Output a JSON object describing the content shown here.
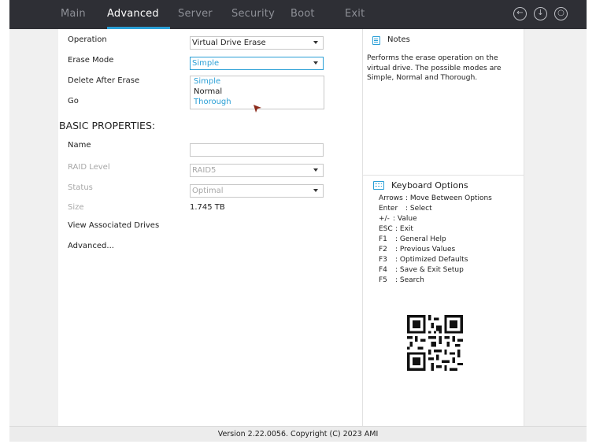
{
  "tabs": [
    {
      "label": "Main"
    },
    {
      "label": "Advanced"
    },
    {
      "label": "Server"
    },
    {
      "label": "Security"
    },
    {
      "label": "Boot"
    },
    {
      "label": "Exit"
    }
  ],
  "active_tab": "Advanced",
  "top_icons": [
    "back-icon",
    "save-icon",
    "search-icon"
  ],
  "form": {
    "operation_label": "Operation",
    "operation_value": "Virtual Drive Erase",
    "erase_mode_label": "Erase Mode",
    "erase_mode_value": "Simple",
    "erase_mode_options": [
      "Simple",
      "Normal",
      "Thorough"
    ],
    "delete_after_erase_label": "Delete After Erase",
    "go_label": "Go"
  },
  "basic_properties": {
    "heading": "BASIC PROPERTIES:",
    "name_label": "Name",
    "name_value": "",
    "raid_level_label": "RAID Level",
    "raid_level_value": "RAID5",
    "status_label": "Status",
    "status_value": "Optimal",
    "size_label": "Size",
    "size_value": "1.745 TB",
    "view_drives_label": "View Associated Drives",
    "advanced_label": "Advanced..."
  },
  "notes": {
    "title": "Notes",
    "text": "Performs the erase operation on the virtual drive. The possible modes are Simple, Normal and Thorough."
  },
  "keyboard": {
    "title": "Keyboard Options",
    "items": [
      {
        "key": "Arrows",
        "desc": ": Move Between Options"
      },
      {
        "key": "Enter",
        "desc": ": Select"
      },
      {
        "key": "+/-",
        "desc": ": Value"
      },
      {
        "key": "ESC",
        "desc": ": Exit"
      },
      {
        "key": "F1",
        "desc": ": General Help"
      },
      {
        "key": "F2",
        "desc": ": Previous Values"
      },
      {
        "key": "F3",
        "desc": ": Optimized Defaults"
      },
      {
        "key": "F4",
        "desc": ": Save & Exit Setup"
      },
      {
        "key": "F5",
        "desc": ": Search"
      }
    ]
  },
  "footer": {
    "text": "Version 2.22.0056. Copyright (C) 2023 AMI"
  },
  "colors": {
    "accent": "#2a9fd6",
    "topbar": "#2e2f35",
    "cursor": "#8b2a1a"
  }
}
